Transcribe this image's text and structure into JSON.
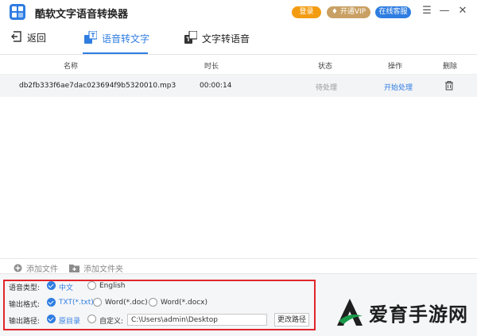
{
  "app": {
    "title": "酷软文字语音转换器",
    "login_label": "登录",
    "vip_label": "开通VIP",
    "service_label": "在线客服",
    "controls": [
      "menu-icon",
      "minimize-icon",
      "close-icon"
    ]
  },
  "nav": {
    "back": "返回",
    "speech_to_text": "语音转文字",
    "text_to_speech": "文字转语音"
  },
  "table": {
    "headers": {
      "name": "名称",
      "duration": "时长",
      "status": "状态",
      "action": "操作",
      "delete": "删除"
    },
    "rows": [
      {
        "name": "db2fb333f6ae7dac023694f9b5320010.mp3",
        "duration": "00:00:14",
        "status": "待处理",
        "action": "开始处理",
        "delete_icon": "trash-icon"
      }
    ]
  },
  "toolbar": {
    "add_file": "添加文件",
    "add_folder": "添加文件夹"
  },
  "settings": {
    "voice_type_label": "语音类型:",
    "voice_options": [
      "中文",
      "English"
    ],
    "voice_selected": "中文",
    "format_label": "输出格式:",
    "format_options": [
      "TXT(*.txt)",
      "Word(*.doc)",
      "Word(*.docx)"
    ],
    "format_selected": "TXT(*.txt)",
    "path_label": "输出路径:",
    "path_options": [
      "原目录",
      "自定义:"
    ],
    "path_selected": "原目录",
    "path_value": "C:\\Users\\admin\\Desktop",
    "change_path": "更改路径"
  },
  "watermark": {
    "text": "爱育手游网"
  },
  "colors": {
    "accent": "#2f7de1",
    "login": "#f39c12",
    "vip": "#c9a063",
    "highlight_border": "#e0262b",
    "watermark_green": "#1a9b4a"
  }
}
